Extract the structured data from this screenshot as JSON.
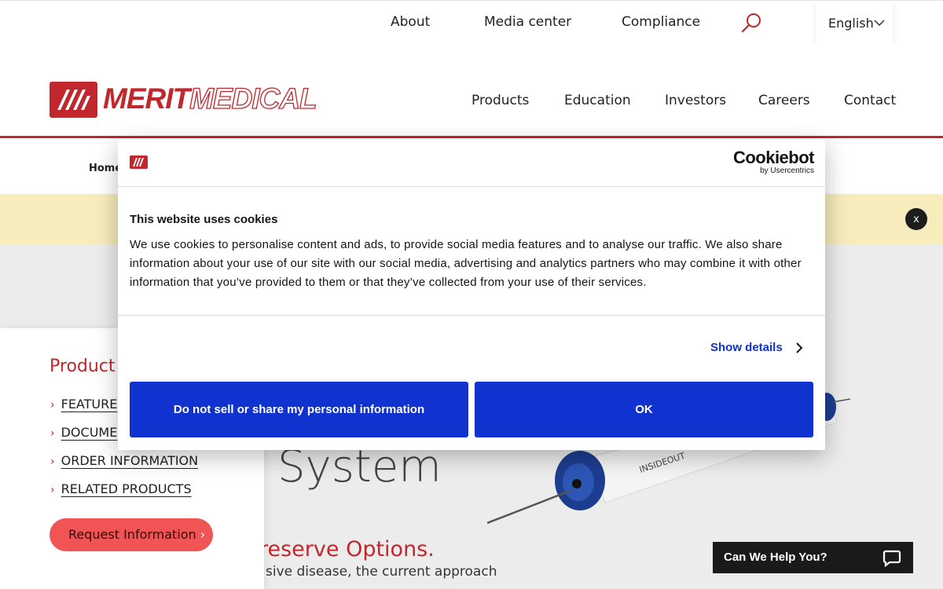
{
  "top_nav": {
    "links": [
      "About",
      "Media center",
      "Compliance"
    ],
    "language": "English"
  },
  "logo": {
    "word1": "MERIT",
    "word2": "MEDICAL"
  },
  "main_nav": [
    "Products",
    "Education",
    "Investors",
    "Careers",
    "Contact"
  ],
  "breadcrumb": {
    "home": "Home"
  },
  "banner": {
    "close_label": "x"
  },
  "product_panel": {
    "title": "Product",
    "links": [
      "FEATURE",
      "DOCUME",
      "ORDER INFORMATION",
      "RELATED PRODUCTS"
    ],
    "request_button": "Request Information"
  },
  "hero": {
    "title": "System",
    "subtitle": "reserve Options.",
    "body": "sive disease, the current approach",
    "device_label": "INSIDEOUT"
  },
  "chat": {
    "label": "Can We Help You?"
  },
  "cookie_dialog": {
    "brand": "Cookiebot",
    "brand_sub": "by Usercentrics",
    "title": "This website uses cookies",
    "text": "We use cookies to personalise content and ads, to provide social media features and to analyse our traffic. We also share information about your use of our site with our social media, advertising and analytics partners who may combine it with other information that you’ve provided to them or that they’ve collected from your use of their services.",
    "show_details": "Show details",
    "deny_button": "Do not sell or share my personal information",
    "ok_button": "OK"
  },
  "colors": {
    "brand_red": "#c1272d",
    "cookie_blue": "#1032cf",
    "banner_yellow": "#f6ecbc"
  },
  "icons": [
    "search-icon",
    "chevron-down-icon",
    "chevron-right-icon",
    "chat-icon",
    "close-icon"
  ]
}
